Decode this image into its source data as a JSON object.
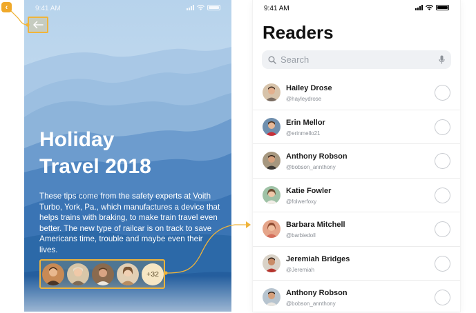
{
  "colors": {
    "accent": "#f0b43a",
    "sky_top": "#c7ddf0",
    "mountain_deep": "#2c69a8",
    "list_divider": "#ececec"
  },
  "left_screen": {
    "status_time": "9:41 AM",
    "back_icon": "arrow-left-icon",
    "title_line1": "Holiday",
    "title_line2": "Travel 2018",
    "description": "These tips come from the safety experts at Voith Turbo, York, Pa., which manufactures a device that helps trains with braking, to make train travel even better. The new type of railcar is on track to save Americans time, trouble and maybe even their lives.",
    "avatar_group": {
      "avatar_count": 4,
      "more_label": "+32"
    }
  },
  "annotation": {
    "badge_icon": "chevron-left-icon",
    "badge_label": "‹"
  },
  "right_screen": {
    "status_time": "9:41 AM",
    "title": "Readers",
    "search": {
      "placeholder": "Search",
      "search_icon": "magnifier-icon",
      "mic_icon": "microphone-icon"
    },
    "readers": [
      {
        "name": "Hailey Drose",
        "handle": "@hayleydrose"
      },
      {
        "name": "Erin Mellor",
        "handle": "@erinmello21"
      },
      {
        "name": "Anthony Robson",
        "handle": "@bobson_annthony"
      },
      {
        "name": "Katie Fowler",
        "handle": "@folwerfoxy"
      },
      {
        "name": "Barbara Mitchell",
        "handle": "@barbiedoll"
      },
      {
        "name": "Jeremiah Bridges",
        "handle": "@Jeremiah"
      },
      {
        "name": "Anthony Robson",
        "handle": "@bobson_annthony"
      }
    ]
  }
}
